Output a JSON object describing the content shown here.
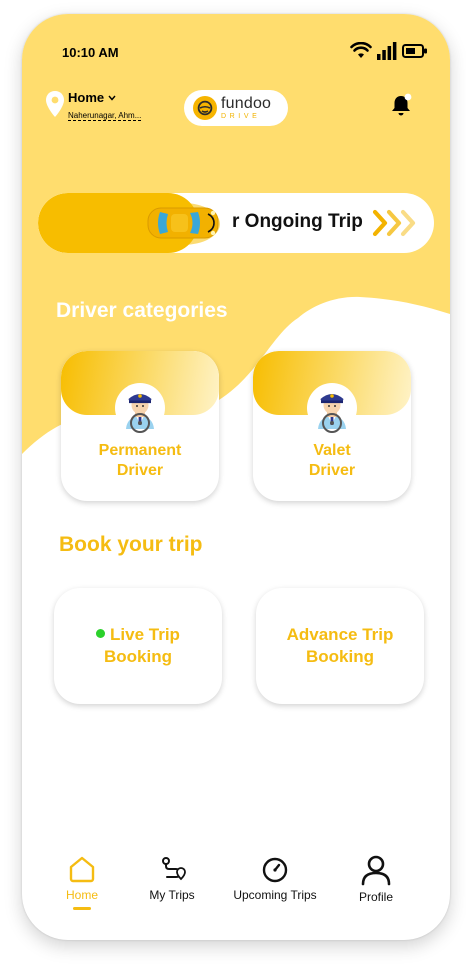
{
  "status_bar": {
    "time": "10:10 AM"
  },
  "header": {
    "location_label": "Home",
    "location_address": "Naherunagar, Ahm...",
    "logo_brand": "fundoo",
    "logo_sub": "DRIVE"
  },
  "ongoing_trip": {
    "label": "r Ongoing Trip"
  },
  "driver_categories": {
    "title": "Driver categories",
    "items": [
      {
        "line1": "Permanent",
        "line2": "Driver"
      },
      {
        "line1": "Valet",
        "line2": "Driver"
      }
    ]
  },
  "book_trip": {
    "title": "Book your trip",
    "items": [
      {
        "line1": "Live Trip",
        "line2": "Booking",
        "live": true
      },
      {
        "line1": "Advance Trip",
        "line2": "Booking",
        "live": false
      }
    ]
  },
  "bottom_nav": {
    "items": [
      {
        "label": "Home",
        "icon": "home-icon",
        "active": true
      },
      {
        "label": "My Trips",
        "icon": "route-icon",
        "active": false
      },
      {
        "label": "Upcoming Trips",
        "icon": "clock-icon",
        "active": false
      },
      {
        "label": "Profile",
        "icon": "user-icon",
        "active": false
      }
    ]
  },
  "colors": {
    "primary_yellow": "#FFDD6E",
    "accent_yellow": "#F7BD00",
    "text_yellow": "#F5BC12",
    "live_green": "#2BD12B"
  }
}
